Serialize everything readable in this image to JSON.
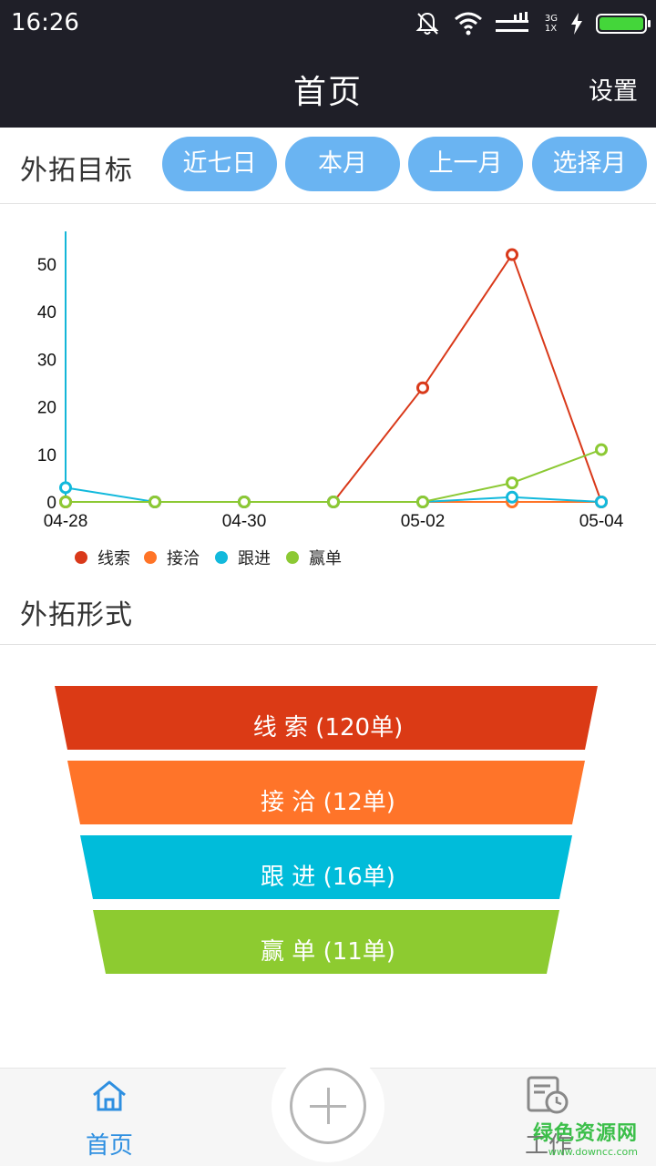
{
  "status_bar": {
    "time": "16:26",
    "network_type": "3G",
    "network_sub": "1X",
    "icons": [
      "mute-icon",
      "wifi-icon",
      "signal-icon",
      "charging-icon",
      "battery-icon"
    ]
  },
  "header": {
    "title": "首页",
    "settings_label": "设置"
  },
  "target_section": {
    "title": "外拓目标",
    "filters": [
      "近七日",
      "本月",
      "上一月",
      "选择月"
    ]
  },
  "chart_data": {
    "type": "line",
    "x": [
      "04-28",
      "04-29",
      "04-30",
      "05-01",
      "05-02",
      "05-03",
      "05-04"
    ],
    "x_tick_labels": [
      "04-28",
      "04-30",
      "05-02",
      "05-04"
    ],
    "y_tick_labels": [
      "0",
      "10",
      "20",
      "30",
      "40",
      "50"
    ],
    "ylim": [
      0,
      57
    ],
    "grid": false,
    "legend_position": "bottom-left",
    "series": [
      {
        "name": "线索",
        "color": "#d9391a",
        "values": [
          0,
          0,
          0,
          0,
          24,
          52,
          0
        ]
      },
      {
        "name": "接洽",
        "color": "#ff7427",
        "values": [
          0,
          0,
          0,
          0,
          0,
          0,
          0
        ]
      },
      {
        "name": "跟进",
        "color": "#12b9dc",
        "values": [
          3,
          0,
          0,
          0,
          0,
          1,
          0
        ]
      },
      {
        "name": "赢单",
        "color": "#8cc934",
        "values": [
          0,
          0,
          0,
          0,
          0,
          4,
          11
        ]
      }
    ]
  },
  "form_section": {
    "title": "外拓形式"
  },
  "funnel": {
    "stages": [
      {
        "label": "线 索 (120单)",
        "color": "#db3a15"
      },
      {
        "label": "接 洽 (12单)",
        "color": "#ff7429"
      },
      {
        "label": "跟 进 (16单)",
        "color": "#00bcda"
      },
      {
        "label": "赢 单 (11单)",
        "color": "#8dcb30"
      }
    ]
  },
  "bottom_nav": {
    "home_label": "首页",
    "work_label": "工作",
    "home_color": "#2e8fe0"
  },
  "watermark": {
    "main": "绿色资源网",
    "sub": "www.downcc.com"
  }
}
